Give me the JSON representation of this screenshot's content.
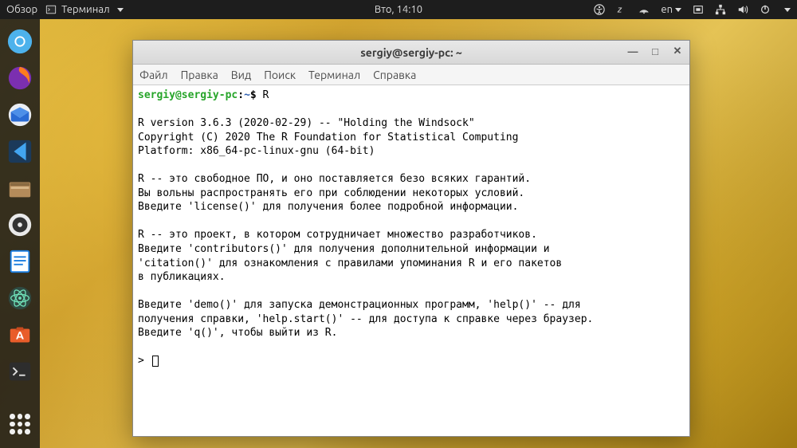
{
  "topbar": {
    "activities": "Обзор",
    "app_label": "Терминал",
    "datetime": "Вто, 14:10",
    "lang": "en"
  },
  "dock": {
    "items": [
      {
        "name": "chromium",
        "color": "#4db2ec"
      },
      {
        "name": "firefox",
        "color": "#ff7c1f"
      },
      {
        "name": "thunderbird",
        "color": "#2a6bd4"
      },
      {
        "name": "vscode",
        "color": "#2b8fd6"
      },
      {
        "name": "files",
        "color": "#b48b5a"
      },
      {
        "name": "rhythmbox",
        "color": "#e9e9e9"
      },
      {
        "name": "libreoffice-writer",
        "color": "#1a7de0"
      },
      {
        "name": "atom",
        "color": "#47c28b"
      },
      {
        "name": "software",
        "color": "#e95d2a"
      },
      {
        "name": "terminal",
        "color": "#2d2d2d"
      }
    ]
  },
  "window": {
    "title": "sergiy@sergiy-pc: ~",
    "menu": [
      "Файл",
      "Правка",
      "Вид",
      "Поиск",
      "Терминал",
      "Справка"
    ]
  },
  "terminal": {
    "prompt_user": "sergiy@sergiy-pc",
    "prompt_path": "~",
    "prompt_suffix": "$",
    "command": "R",
    "output_lines": [
      "",
      "R version 3.6.3 (2020-02-29) -- \"Holding the Windsock\"",
      "Copyright (C) 2020 The R Foundation for Statistical Computing",
      "Platform: x86_64-pc-linux-gnu (64-bit)",
      "",
      "R -- это свободное ПО, и оно поставляется безо всяких гарантий.",
      "Вы вольны распространять его при соблюдении некоторых условий.",
      "Введите 'license()' для получения более подробной информации.",
      "",
      "R -- это проект, в котором сотрудничает множество разработчиков.",
      "Введите 'contributors()' для получения дополнительной информации и",
      "'citation()' для ознакомления с правилами упоминания R и его пакетов",
      "в публикациях.",
      "",
      "Введите 'demo()' для запуска демонстрационных программ, 'help()' -- для",
      "получения справки, 'help.start()' -- для доступа к справке через браузер.",
      "Введите 'q()', чтобы выйти из R.",
      ""
    ],
    "next_prompt": ">"
  }
}
